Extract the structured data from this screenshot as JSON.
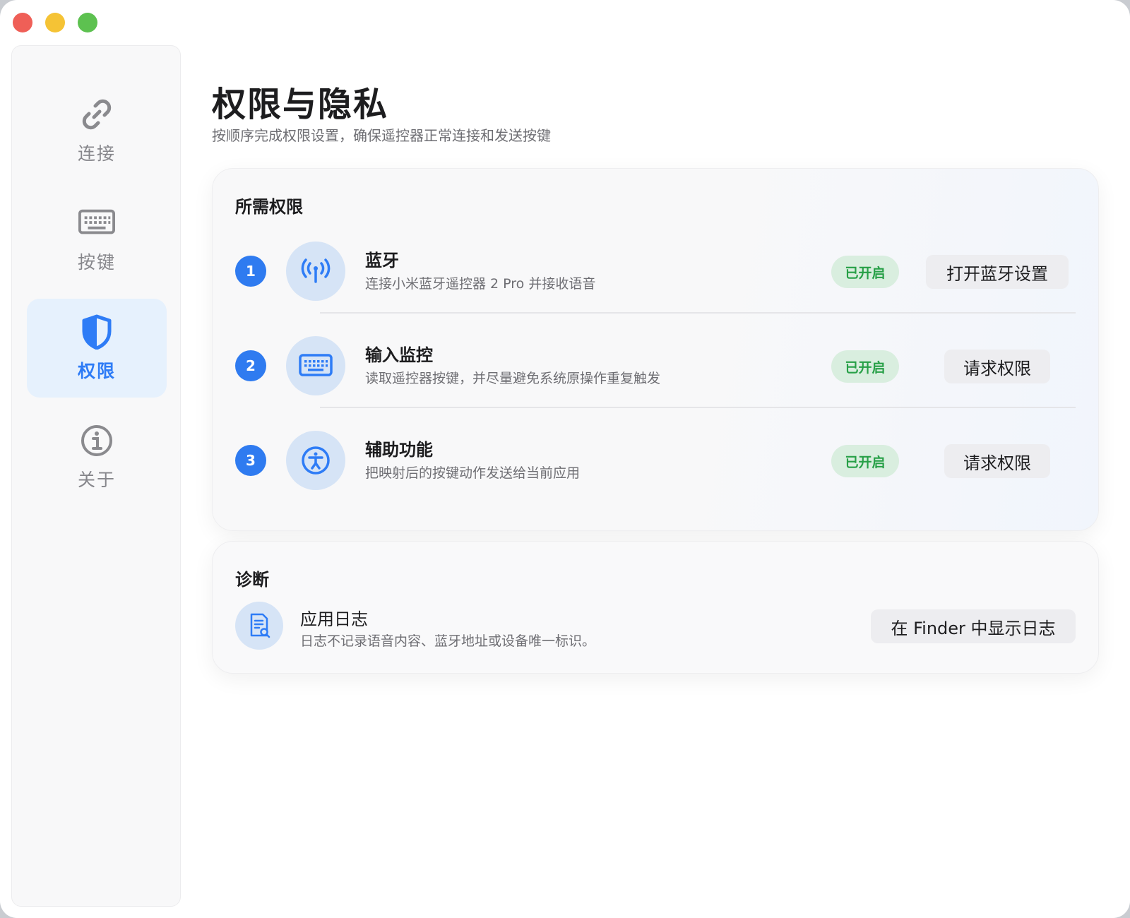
{
  "sidebar": {
    "items": [
      {
        "label": "连接",
        "icon": "link-icon",
        "active": false
      },
      {
        "label": "按键",
        "icon": "keyboard-icon",
        "active": false
      },
      {
        "label": "权限",
        "icon": "shield-icon",
        "active": true
      },
      {
        "label": "关于",
        "icon": "info-icon",
        "active": false
      }
    ]
  },
  "header": {
    "title": "权限与隐私",
    "subtitle": "按顺序完成权限设置，确保遥控器正常连接和发送按键"
  },
  "permissions": {
    "title": "所需权限",
    "items": [
      {
        "number": "1",
        "icon": "antenna-icon",
        "name": "蓝牙",
        "desc": "连接小米蓝牙遥控器 2 Pro 并接收语音",
        "status": "已开启",
        "button": "打开蓝牙设置"
      },
      {
        "number": "2",
        "icon": "keyboard-icon",
        "name": "输入监控",
        "desc": "读取遥控器按键，并尽量避免系统原操作重复触发",
        "status": "已开启",
        "button": "请求权限"
      },
      {
        "number": "3",
        "icon": "accessibility-icon",
        "name": "辅助功能",
        "desc": "把映射后的按键动作发送给当前应用",
        "status": "已开启",
        "button": "请求权限"
      }
    ]
  },
  "diagnostics": {
    "title": "诊断",
    "log": {
      "icon": "document-search-icon",
      "name": "应用日志",
      "desc": "日志不记录语音内容、蓝牙地址或设备唯一标识。",
      "button": "在 Finder 中显示日志"
    }
  },
  "colors": {
    "accent": "#2e7cf6",
    "status_green": "#27a047",
    "status_bg": "#d9eedf",
    "icon_bg": "#d6e4f6",
    "active_sidebar_bg": "#e6f1fd"
  }
}
